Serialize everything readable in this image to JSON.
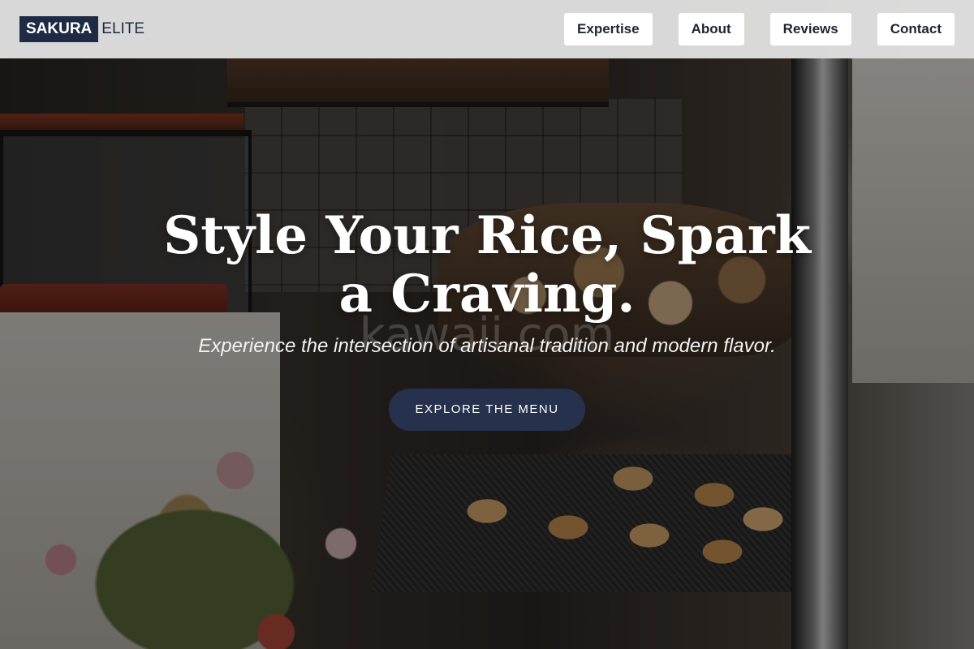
{
  "brand": {
    "name_primary": "SAKURA",
    "name_secondary": "ELITE"
  },
  "nav": {
    "items": [
      {
        "label": "Expertise"
      },
      {
        "label": "About"
      },
      {
        "label": "Reviews"
      },
      {
        "label": "Contact"
      }
    ]
  },
  "hero": {
    "headline": "Style Your Rice, Spark a Craving.",
    "subtitle": "Experience the intersection of artisanal tradition and modern flavor.",
    "cta_label": "EXPLORE THE MENU",
    "watermark": "kawaii.com"
  },
  "colors": {
    "brand_navy": "#1f2a44",
    "cta_navy": "#26314e",
    "header_bg": "#e4e4e4"
  }
}
